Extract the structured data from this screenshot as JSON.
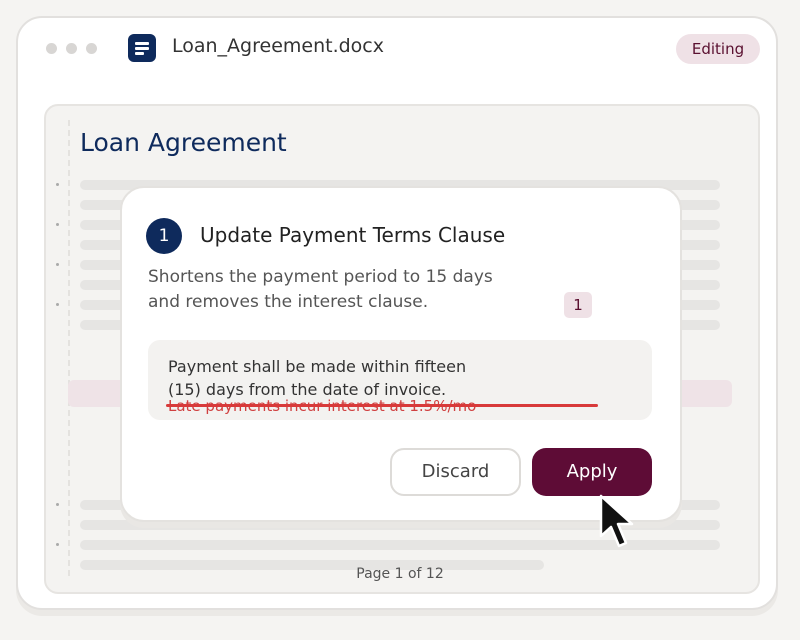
{
  "window": {
    "file_name": "Loan_Agreement.docx",
    "status_badge": "Editing",
    "file_icon": "document-icon"
  },
  "document": {
    "heading": "Loan Agreement",
    "page_indicator": "Page 1 of 12"
  },
  "dialog": {
    "step_number": "1",
    "title": "Update Payment Terms Clause",
    "description_line1": "Shortens the payment period to 15 days",
    "description_line2": "and removes the interest clause.",
    "reference_badge": "1",
    "clause_new_line1": "Payment shall be made within fifteen",
    "clause_new_line2": "(15) days from the date of invoice.",
    "clause_removed": "Late payments incur interest at 1.5%/mo",
    "discard_label": "Discard",
    "apply_label": "Apply"
  },
  "colors": {
    "brand_navy": "#0e2a5c",
    "apply_maroon": "#5e0c36",
    "deletion_red": "#d83a3a",
    "badge_pink": "#efe1e6"
  }
}
